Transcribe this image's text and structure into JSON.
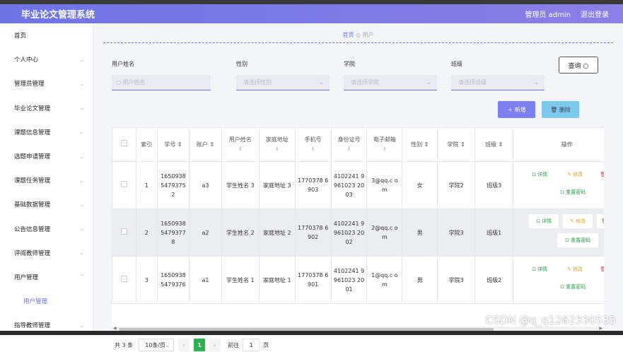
{
  "header": {
    "title": "毕业论文管理系统",
    "admin_label": "管理员 admin",
    "logout": "退出登录"
  },
  "sidebar": {
    "items": [
      {
        "label": "首页"
      },
      {
        "label": "个人中心"
      },
      {
        "label": "管理员管理"
      },
      {
        "label": "毕业论文管理"
      },
      {
        "label": "课题信息管理"
      },
      {
        "label": "选题申请管理"
      },
      {
        "label": "课题任务管理"
      },
      {
        "label": "基础数据管理"
      },
      {
        "label": "公告信息管理"
      },
      {
        "label": "评阅教师管理"
      },
      {
        "label": "用户管理"
      },
      {
        "label": "用户管理"
      },
      {
        "label": "指导教师管理"
      }
    ]
  },
  "breadcrumb": {
    "home": "首页",
    "sep": "◎",
    "current": "用户"
  },
  "filters": {
    "name_label": "用户姓名",
    "name_placeholder": "用户姓名",
    "sex_label": "性别",
    "sex_placeholder": "请选择性别",
    "college_label": "学院",
    "college_placeholder": "请选择学院",
    "class_label": "班级",
    "class_placeholder": "请选择班级",
    "query": "查询 ○"
  },
  "actions": {
    "add": "＋ 新增",
    "delete": "🗑 删除"
  },
  "table": {
    "columns": [
      "索引",
      "学号 ⇕",
      "账户 ⇕",
      "用户姓名",
      "家庭地址",
      "手机号",
      "身份证号",
      "电子邮箱",
      "性别 ⇕",
      "学院 ⇕",
      "班级 ⇕",
      "操作"
    ],
    "rows": [
      {
        "index": "1",
        "sno": "1650938 5479375 2",
        "account": "a3",
        "name": "学生姓名 3",
        "address": "家庭地址 3",
        "phone": "1770378 6903",
        "idcard": "4102241 9961023 2003",
        "email": "3@qq.c om",
        "sex": "女",
        "college": "学院2",
        "class": "班级3"
      },
      {
        "index": "2",
        "sno": "1650938 5479377 8",
        "account": "a2",
        "name": "学生姓名 2",
        "address": "家庭地址 2",
        "phone": "1770378 6902",
        "idcard": "4102241 9961023 2002",
        "email": "2@qq.c om",
        "sex": "男",
        "college": "学院3",
        "class": "班级1"
      },
      {
        "index": "3",
        "sno": "1650938 5479376",
        "account": "a1",
        "name": "学生姓名 1",
        "address": "家庭地址 1",
        "phone": "1770378 6901",
        "idcard": "4102241 9961023 2001",
        "email": "1@qq.c om",
        "sex": "男",
        "college": "学院3",
        "class": "班级2"
      }
    ],
    "op_detail": "详情",
    "op_modify": "修改",
    "op_delete": "删",
    "op_reset": "重置密码"
  },
  "pager": {
    "total": "共 3 条",
    "size": "10条/页",
    "page": "1",
    "goto": "前往",
    "goto_value": "1",
    "page_suffix": "页"
  },
  "watermark": "CSDN @q_q1262330535",
  "colors": {
    "accent": "#6e74e6",
    "add": "#7b7ff0",
    "delete": "#7cc8ec",
    "page_active": "#2bb24c"
  }
}
